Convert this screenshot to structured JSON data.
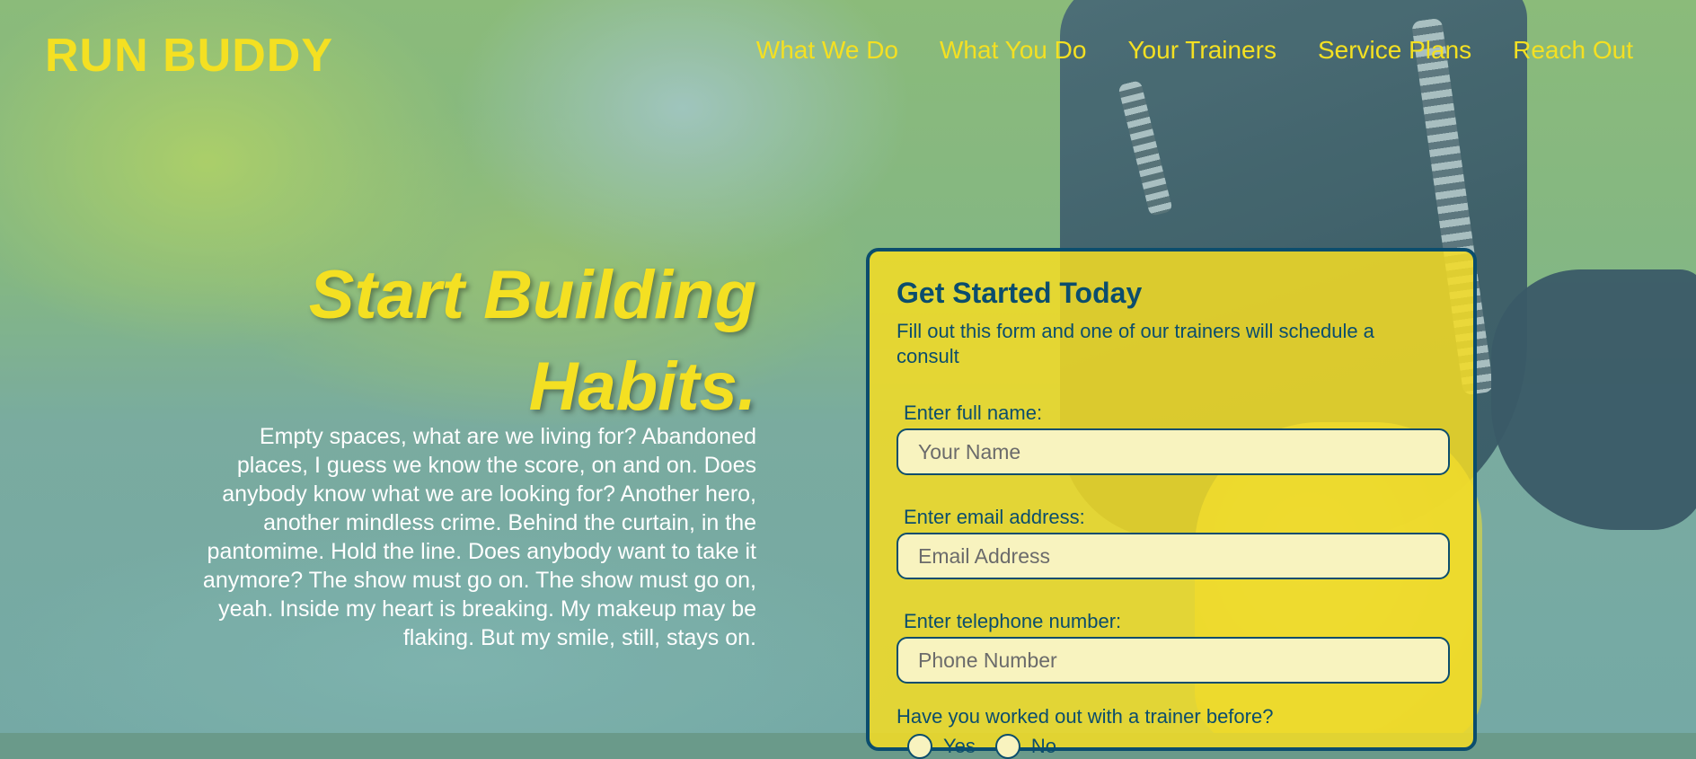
{
  "header": {
    "logo": "RUN BUDDY",
    "nav": [
      "What We Do",
      "What You Do",
      "Your Trainers",
      "Service Plans",
      "Reach Out"
    ]
  },
  "hero": {
    "heading_line1": "Start Building",
    "heading_line2": "Habits.",
    "body": "Empty spaces, what are we living for? Abandoned places, I guess we know the score, on and on. Does anybody know what we are looking for? Another hero, another mindless crime. Behind the curtain, in the pantomime. Hold the line. Does anybody want to take it anymore? The show must go on. The show must go on, yeah. Inside my heart is breaking. My makeup may be flaking. But my smile, still, stays on."
  },
  "form": {
    "title": "Get Started Today",
    "subtitle": "Fill out this form and one of our trainers will schedule a consult",
    "name_label": "Enter full name:",
    "name_placeholder": "Your Name",
    "email_label": "Enter email address:",
    "email_placeholder": "Email Address",
    "phone_label": "Enter telephone number:",
    "phone_placeholder": "Phone Number",
    "question": "Have you worked out with a trainer before?",
    "options": [
      "Yes",
      "No"
    ]
  },
  "colors": {
    "accent_yellow": "#f4e022",
    "form_border": "#0b4d6d",
    "input_bg": "#f8f3bf"
  }
}
